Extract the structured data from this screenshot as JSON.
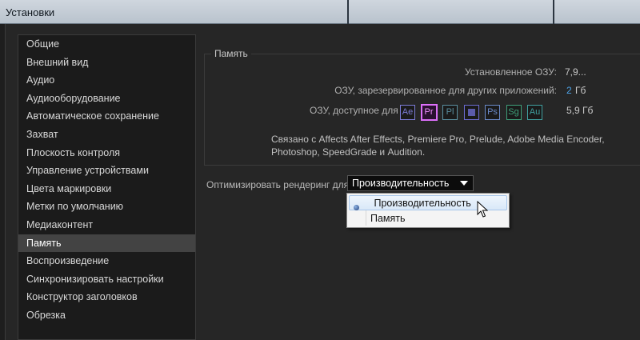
{
  "window": {
    "title": "Установки"
  },
  "sidebar": {
    "items": [
      {
        "label": "Общие"
      },
      {
        "label": "Внешний вид"
      },
      {
        "label": "Аудио"
      },
      {
        "label": "Аудиооборудование"
      },
      {
        "label": "Автоматическое сохранение"
      },
      {
        "label": "Захват"
      },
      {
        "label": "Плоскость контроля"
      },
      {
        "label": "Управление устройствами"
      },
      {
        "label": "Цвета маркировки"
      },
      {
        "label": "Метки по умолчанию"
      },
      {
        "label": "Медиаконтент"
      },
      {
        "label": "Память"
      },
      {
        "label": "Воспроизведение"
      },
      {
        "label": "Синхронизировать настройки"
      },
      {
        "label": "Конструктор заголовков"
      },
      {
        "label": "Обрезка"
      }
    ],
    "selected": "Память"
  },
  "memory": {
    "group_title": "Память",
    "installed_label": "Установленное ОЗУ:",
    "installed_value": "7,9...",
    "reserved_label": "ОЗУ, зарезервированное для других приложений:",
    "reserved_value": "2",
    "reserved_unit": "Гб",
    "available_label": "ОЗУ, доступное для",
    "available_value": "5,9 Гб",
    "apps": [
      {
        "abbr": "Ae",
        "color": "#7b7bd6",
        "selected": false,
        "icon": "after-effects-icon"
      },
      {
        "abbr": "Pr",
        "color": "#d66cf0",
        "selected": true,
        "icon": "premiere-pro-icon"
      },
      {
        "abbr": "Pl",
        "color": "#5a8fa0",
        "selected": false,
        "icon": "prelude-icon"
      },
      {
        "abbr": "",
        "color": "#6b6bd0",
        "selected": false,
        "icon": "media-encoder-icon"
      },
      {
        "abbr": "Ps",
        "color": "#6a8ac8",
        "selected": false,
        "icon": "photoshop-icon"
      },
      {
        "abbr": "Sg",
        "color": "#3fa07a",
        "selected": false,
        "icon": "speedgrade-icon"
      },
      {
        "abbr": "Au",
        "color": "#40a0a0",
        "selected": false,
        "icon": "audition-icon"
      }
    ],
    "linked_text": "Связано с Affects After Effects, Premiere Pro, Prelude, Adobe Media Encoder, Photoshop, SpeedGrade и Audition."
  },
  "render": {
    "label": "Оптимизировать рендеринг для:",
    "selected": "Производительность",
    "options": [
      "Производительность",
      "Память"
    ]
  },
  "colors": {
    "accent_blue": "#4da3e8",
    "background": "#262626",
    "selected_item": "#434343"
  }
}
